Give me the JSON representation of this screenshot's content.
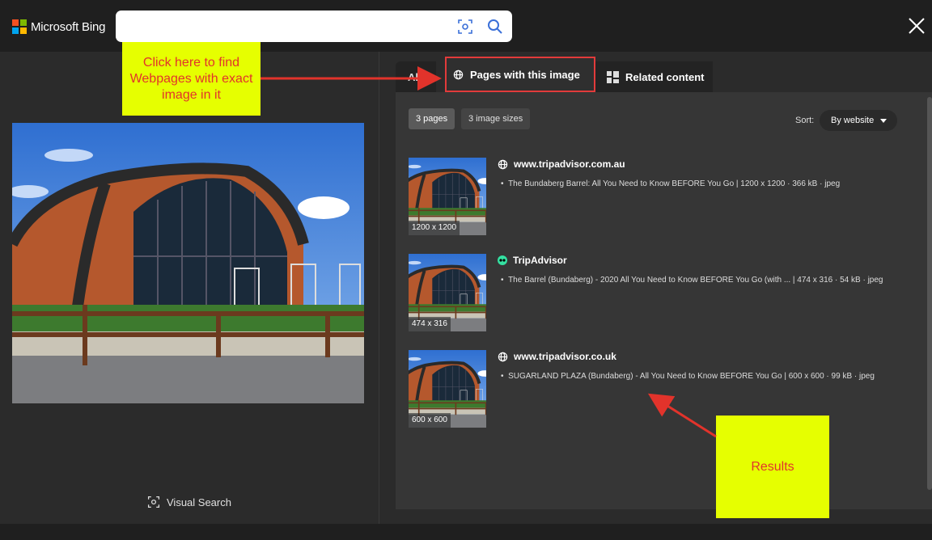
{
  "brand": {
    "name": "Microsoft Bing"
  },
  "search": {
    "value": "",
    "placeholder": ""
  },
  "tabs": [
    {
      "label": "All"
    },
    {
      "label": "Pages with this image"
    },
    {
      "label": "Related content"
    }
  ],
  "filters": {
    "pages_chip": "3 pages",
    "sizes_chip": "3 image sizes"
  },
  "sort": {
    "label": "Sort:",
    "value": "By website"
  },
  "results": [
    {
      "site": "www.tripadvisor.com.au",
      "icon": "globe-icon",
      "description": "The Bundaberg Barrel: All You Need to Know BEFORE You Go | 1200 x 1200 · 366 kB · jpeg",
      "size": "1200 x 1200"
    },
    {
      "site": "TripAdvisor",
      "icon": "tripadvisor-icon",
      "description": "The Barrel (Bundaberg) - 2020 All You Need to Know BEFORE You Go (with ... | 474 x 316 · 54 kB · jpeg",
      "size": "474 x 316"
    },
    {
      "site": "www.tripadvisor.co.uk",
      "icon": "globe-icon",
      "description": "SUGARLAND PLAZA (Bundaberg) - All You Need to Know BEFORE You Go | 600 x 600 · 99 kB · jpeg",
      "size": "600 x 600"
    }
  ],
  "visual_search": {
    "label": "Visual Search"
  },
  "annotations": {
    "callout_1": "Click here to find Webpages with exact image in it",
    "callout_2": "Results"
  },
  "colors": {
    "highlight_border": "#e23b3b",
    "callout_bg": "#e6ff00",
    "callout_text": "#e2332b",
    "tripadvisor_green": "#34e0a1"
  }
}
